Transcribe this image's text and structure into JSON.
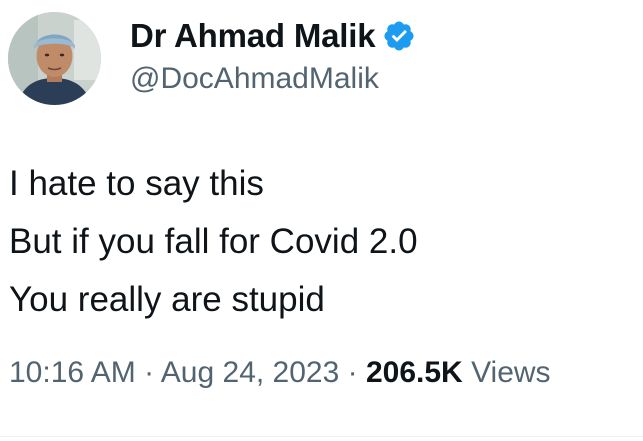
{
  "author": {
    "display_name": "Dr Ahmad Malik",
    "handle": "@DocAhmadMalik",
    "verified_icon": "verified-badge-icon",
    "verified_color": "#1d9bf0"
  },
  "tweet": {
    "lines": [
      "I hate to say this",
      "But if you fall for Covid 2.0",
      "You really are stupid"
    ],
    "time": "10:16 AM",
    "separator": "·",
    "date": "Aug 24, 2023",
    "views_count": "206.5K",
    "views_label": "Views"
  },
  "colors": {
    "text_primary": "#0f1419",
    "text_secondary": "#536471",
    "background": "#ffffff"
  }
}
